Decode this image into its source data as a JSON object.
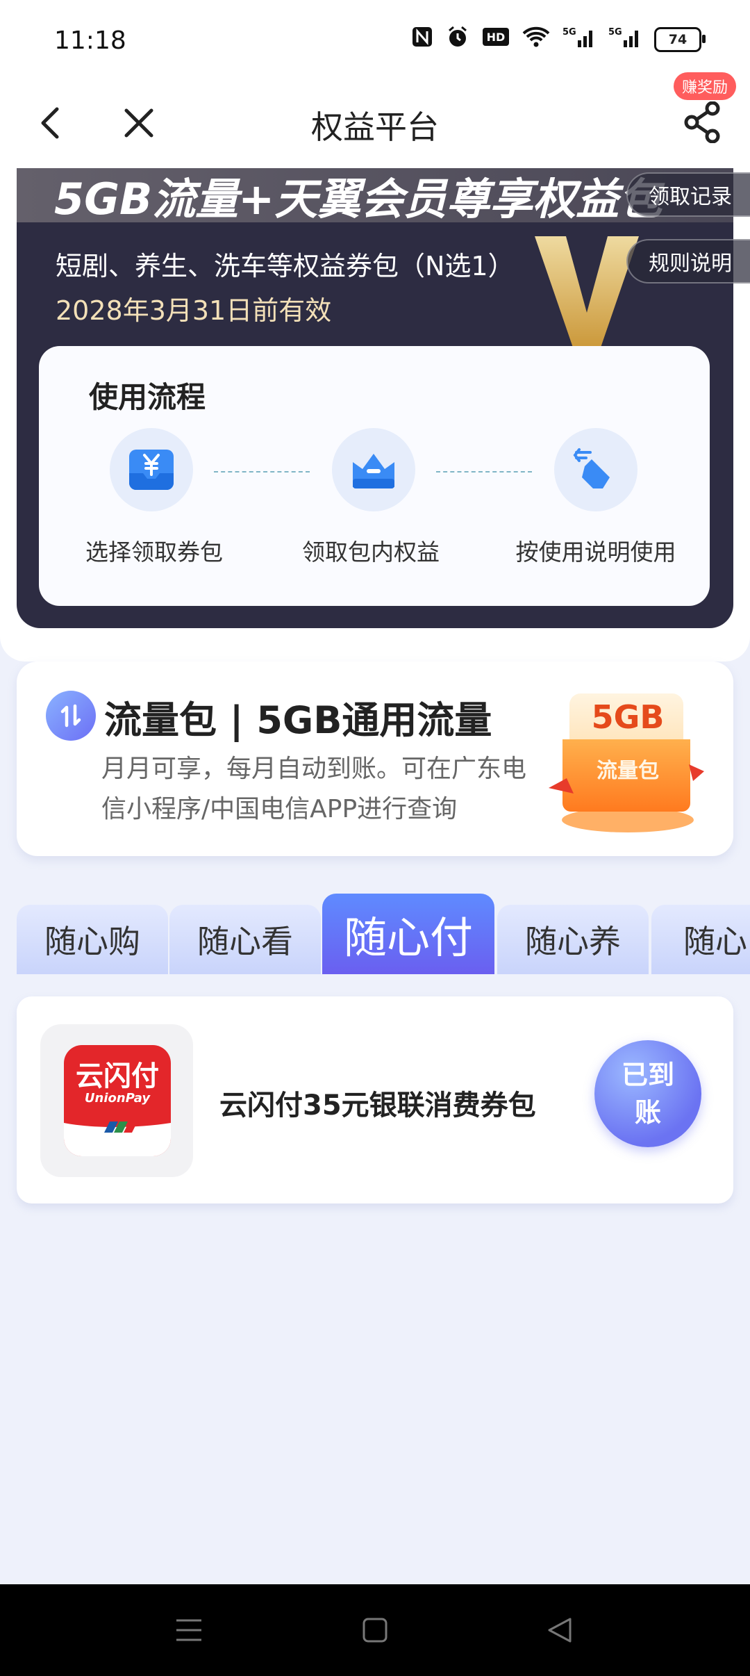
{
  "status_bar": {
    "time": "11:18",
    "battery": "74",
    "icons": [
      "nfc-icon",
      "alarm-icon",
      "hd-icon",
      "wifi-icon",
      "signal-5g-icon",
      "signal-5g-icon"
    ],
    "hd_text": "HD",
    "net1": "5G",
    "net2": "5G"
  },
  "nav": {
    "title": "权益平台",
    "reward_badge": "赚奖励"
  },
  "hero": {
    "title": "5GB流量+天翼会员尊享权益包",
    "subtitle": "短剧、养生、洗车等权益券包（N选1）",
    "validity": "2028年3月31日前有效",
    "records_button": "领取记录",
    "rules_button": "规则说明"
  },
  "process": {
    "title": "使用流程",
    "steps": [
      {
        "label": "选择领取券包",
        "icon": "wallet-icon"
      },
      {
        "label": "领取包内权益",
        "icon": "crown-icon"
      },
      {
        "label": "按使用说明使用",
        "icon": "tap-hand-icon"
      }
    ]
  },
  "traffic": {
    "title": "流量包 | 5GB通用流量",
    "description": "月月可享，每月自动到账。可在广东电信小程序/中国电信APP进行查询",
    "gift_size": "5GB",
    "gift_label": "流量包"
  },
  "tabs": [
    {
      "label": "随心购",
      "active": false
    },
    {
      "label": "随心看",
      "active": false
    },
    {
      "label": "随心付",
      "active": true
    },
    {
      "label": "随心养",
      "active": false
    },
    {
      "label": "随心",
      "active": false
    }
  ],
  "coupon": {
    "logo_text": "云闪付",
    "logo_sub": "UnionPay",
    "title": "云闪付35元银联消费券包",
    "status": "已到账"
  },
  "colors": {
    "accent": "#6a5ff0",
    "hero_bg": "#2d2c42",
    "badge": "#ff5d5d",
    "unionpay_red": "#e3262a"
  }
}
